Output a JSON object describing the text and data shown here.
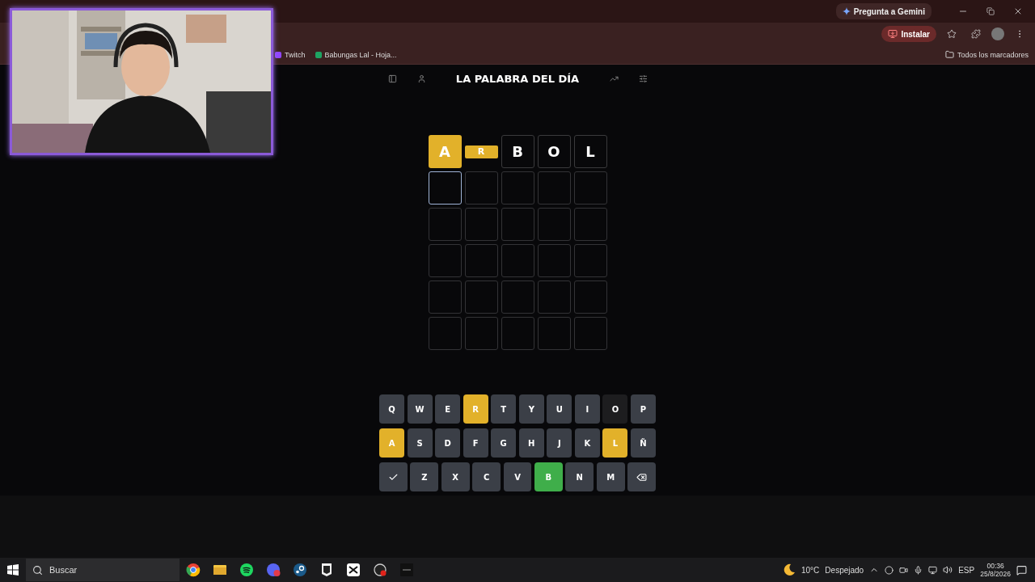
{
  "browser": {
    "gemini_button": "Pregunta a Gemini",
    "install_button": "Instalar",
    "bookmarks": [
      "Twitch",
      "Babungas Lal - Hoja..."
    ],
    "all_bookmarks": "Todos los marcadores"
  },
  "game": {
    "title": "LA PALABRA DEL DÍA",
    "board": [
      [
        {
          "kind": "revealed",
          "letter": "A",
          "color": "#e2b12a",
          "selected": false
        },
        {
          "kind": "revealing",
          "letter": "R",
          "color": "#e2b12a",
          "selected": false
        },
        {
          "kind": "typed",
          "letter": "B",
          "selected": false
        },
        {
          "kind": "typed",
          "letter": "O",
          "selected": false
        },
        {
          "kind": "typed",
          "letter": "L",
          "selected": false
        }
      ],
      [
        {
          "kind": "empty",
          "selected": true
        },
        {
          "kind": "empty",
          "selected": false
        },
        {
          "kind": "empty",
          "selected": false
        },
        {
          "kind": "empty",
          "selected": false
        },
        {
          "kind": "empty",
          "selected": false
        }
      ],
      [
        {
          "kind": "empty",
          "selected": false
        },
        {
          "kind": "empty",
          "selected": false
        },
        {
          "kind": "empty",
          "selected": false
        },
        {
          "kind": "empty",
          "selected": false
        },
        {
          "kind": "empty",
          "selected": false
        }
      ],
      [
        {
          "kind": "empty",
          "selected": false
        },
        {
          "kind": "empty",
          "selected": false
        },
        {
          "kind": "empty",
          "selected": false
        },
        {
          "kind": "empty",
          "selected": false
        },
        {
          "kind": "empty",
          "selected": false
        }
      ],
      [
        {
          "kind": "empty",
          "selected": false
        },
        {
          "kind": "empty",
          "selected": false
        },
        {
          "kind": "empty",
          "selected": false
        },
        {
          "kind": "empty",
          "selected": false
        },
        {
          "kind": "empty",
          "selected": false
        }
      ],
      [
        {
          "kind": "empty",
          "selected": false
        },
        {
          "kind": "empty",
          "selected": false
        },
        {
          "kind": "empty",
          "selected": false
        },
        {
          "kind": "empty",
          "selected": false
        },
        {
          "kind": "empty",
          "selected": false
        }
      ]
    ],
    "keyboard": [
      [
        {
          "kind": "letter",
          "label": "Q",
          "color": "#3b3f47"
        },
        {
          "kind": "letter",
          "label": "W",
          "color": "#3b3f47"
        },
        {
          "kind": "letter",
          "label": "E",
          "color": "#3b3f47"
        },
        {
          "kind": "letter",
          "label": "R",
          "color": "#e2b12a"
        },
        {
          "kind": "letter",
          "label": "T",
          "color": "#3b3f47"
        },
        {
          "kind": "letter",
          "label": "Y",
          "color": "#3b3f47"
        },
        {
          "kind": "letter",
          "label": "U",
          "color": "#3b3f47"
        },
        {
          "kind": "letter",
          "label": "I",
          "color": "#3b3f47"
        },
        {
          "kind": "letter",
          "label": "O",
          "color": "#1d1d1f"
        },
        {
          "kind": "letter",
          "label": "P",
          "color": "#3b3f47"
        }
      ],
      [
        {
          "kind": "letter",
          "label": "A",
          "color": "#e2b12a"
        },
        {
          "kind": "letter",
          "label": "S",
          "color": "#3b3f47"
        },
        {
          "kind": "letter",
          "label": "D",
          "color": "#3b3f47"
        },
        {
          "kind": "letter",
          "label": "F",
          "color": "#3b3f47"
        },
        {
          "kind": "letter",
          "label": "G",
          "color": "#3b3f47"
        },
        {
          "kind": "letter",
          "label": "H",
          "color": "#3b3f47"
        },
        {
          "kind": "letter",
          "label": "J",
          "color": "#3b3f47"
        },
        {
          "kind": "letter",
          "label": "K",
          "color": "#3b3f47"
        },
        {
          "kind": "letter",
          "label": "L",
          "color": "#e2b12a"
        },
        {
          "kind": "letter",
          "label": "Ñ",
          "color": "#3b3f47"
        }
      ],
      [
        {
          "kind": "enter",
          "color": "#3b3f47"
        },
        {
          "kind": "letter",
          "label": "Z",
          "color": "#3b3f47"
        },
        {
          "kind": "letter",
          "label": "X",
          "color": "#3b3f47"
        },
        {
          "kind": "letter",
          "label": "C",
          "color": "#3b3f47"
        },
        {
          "kind": "letter",
          "label": "V",
          "color": "#3b3f47"
        },
        {
          "kind": "letter",
          "label": "B",
          "color": "#3fae4a"
        },
        {
          "kind": "letter",
          "label": "N",
          "color": "#3b3f47"
        },
        {
          "kind": "letter",
          "label": "M",
          "color": "#3b3f47"
        },
        {
          "kind": "backspace",
          "color": "#3b3f47"
        }
      ]
    ]
  },
  "taskbar": {
    "search_placeholder": "Buscar",
    "weather": {
      "temperature": "10°C",
      "condition": "Despejado"
    },
    "language": "ESP",
    "time": "00:36",
    "date": "25/8/2026"
  }
}
